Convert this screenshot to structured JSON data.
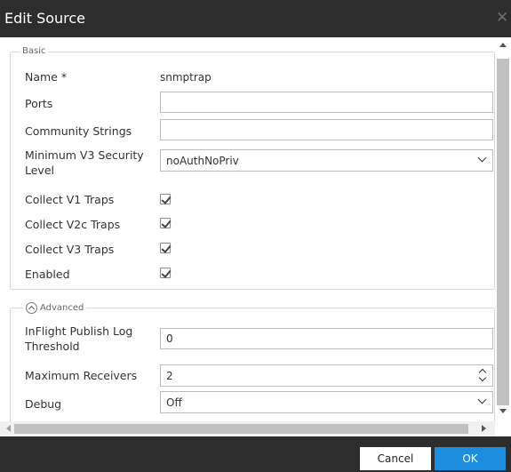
{
  "window": {
    "title": "Edit Source",
    "close_glyph": "✕"
  },
  "basic": {
    "legend": "Basic",
    "name_label": "Name *",
    "name_value": "snmptrap",
    "ports_label": "Ports",
    "ports_value": "",
    "community_label": "Community Strings",
    "community_value": "",
    "min_v3_label_line1": "Minimum V3 Security",
    "min_v3_label_line2": "Level",
    "min_v3_value": "noAuthNoPriv",
    "collect_v1_label": "Collect V1 Traps",
    "collect_v1_checked": true,
    "collect_v2c_label": "Collect V2c Traps",
    "collect_v2c_checked": true,
    "collect_v3_label": "Collect V3 Traps",
    "collect_v3_checked": true,
    "enabled_label": "Enabled",
    "enabled_checked": true
  },
  "advanced": {
    "legend": "Advanced",
    "inflight_label_line1": "InFlight Publish Log",
    "inflight_label_line2": "Threshold",
    "inflight_value": "0",
    "max_receivers_label": "Maximum Receivers",
    "max_receivers_value": "2",
    "debug_label": "Debug",
    "debug_value": "Off"
  },
  "footer": {
    "cancel_label": "Cancel",
    "ok_label": "OK"
  },
  "colors": {
    "titlebar": "#2d2d2d",
    "ok_button": "#1d8ede",
    "border": "#bdbdbd"
  },
  "icons": {
    "close": "close-icon",
    "advanced_toggle": "chevron-up-circle-icon",
    "select_arrow": "chevron-down-icon",
    "spinner": "spinner-arrows-icon",
    "checkbox": "checkmark-icon"
  }
}
